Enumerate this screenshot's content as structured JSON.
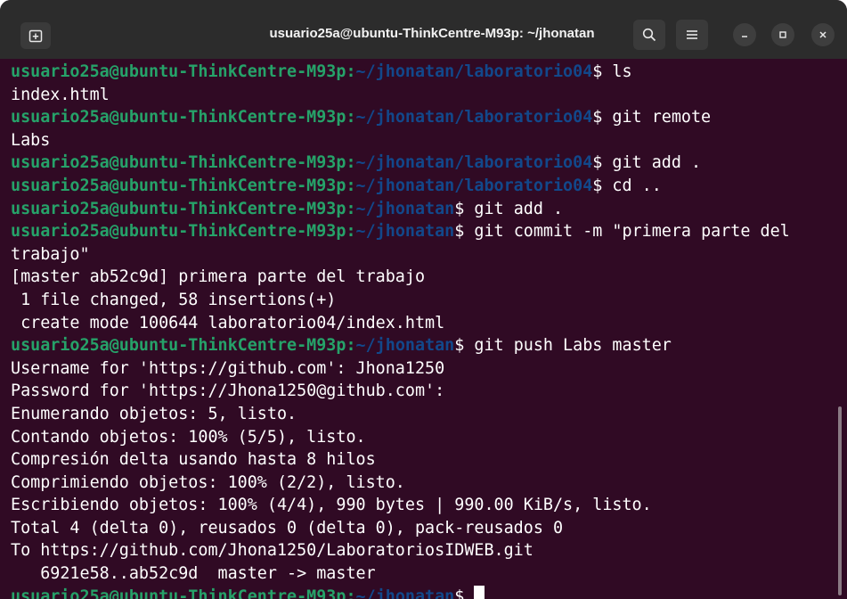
{
  "window": {
    "title": "usuario25a@ubuntu-ThinkCentre-M93p: ~/jhonatan"
  },
  "icons": {
    "new_tab": "new-tab-icon",
    "search": "search-icon",
    "menu": "hamburger-menu-icon",
    "minimize": "minimize-icon",
    "maximize": "maximize-icon",
    "close": "close-icon"
  },
  "colors": {
    "background": "#300a24",
    "prompt_user": "#26a269",
    "prompt_path": "#12488b",
    "text": "#ffffff"
  },
  "terminal": {
    "lines": [
      {
        "user": "usuario25a@ubuntu-ThinkCentre-M93p",
        "sep": ":",
        "path": "~/jhonatan/laboratorio04",
        "cmd": "$ ls"
      },
      {
        "text": "index.html"
      },
      {
        "user": "usuario25a@ubuntu-ThinkCentre-M93p",
        "sep": ":",
        "path": "~/jhonatan/laboratorio04",
        "cmd": "$ git remote"
      },
      {
        "text": "Labs"
      },
      {
        "user": "usuario25a@ubuntu-ThinkCentre-M93p",
        "sep": ":",
        "path": "~/jhonatan/laboratorio04",
        "cmd": "$ git add ."
      },
      {
        "user": "usuario25a@ubuntu-ThinkCentre-M93p",
        "sep": ":",
        "path": "~/jhonatan/laboratorio04",
        "cmd": "$ cd .."
      },
      {
        "user": "usuario25a@ubuntu-ThinkCentre-M93p",
        "sep": ":",
        "path": "~/jhonatan",
        "cmd": "$ git add ."
      },
      {
        "user": "usuario25a@ubuntu-ThinkCentre-M93p",
        "sep": ":",
        "path": "~/jhonatan",
        "cmd": "$ git commit -m \"primera parte del"
      },
      {
        "text": "trabajo\""
      },
      {
        "text": "[master ab52c9d] primera parte del trabajo"
      },
      {
        "text": " 1 file changed, 58 insertions(+)"
      },
      {
        "text": " create mode 100644 laboratorio04/index.html"
      },
      {
        "user": "usuario25a@ubuntu-ThinkCentre-M93p",
        "sep": ":",
        "path": "~/jhonatan",
        "cmd": "$ git push Labs master"
      },
      {
        "text": "Username for 'https://github.com': Jhona1250"
      },
      {
        "text": "Password for 'https://Jhona1250@github.com':"
      },
      {
        "text": "Enumerando objetos: 5, listo."
      },
      {
        "text": "Contando objetos: 100% (5/5), listo."
      },
      {
        "text": "Compresión delta usando hasta 8 hilos"
      },
      {
        "text": "Comprimiendo objetos: 100% (2/2), listo."
      },
      {
        "text": "Escribiendo objetos: 100% (4/4), 990 bytes | 990.00 KiB/s, listo."
      },
      {
        "text": "Total 4 (delta 0), reusados 0 (delta 0), pack-reusados 0"
      },
      {
        "text": "To https://github.com/Jhona1250/LaboratoriosIDWEB.git"
      },
      {
        "text": "   6921e58..ab52c9d  master -> master"
      },
      {
        "user": "usuario25a@ubuntu-ThinkCentre-M93p",
        "sep": ":",
        "path": "~/jhonatan",
        "cmd": "$ ",
        "cursor": true
      }
    ]
  }
}
